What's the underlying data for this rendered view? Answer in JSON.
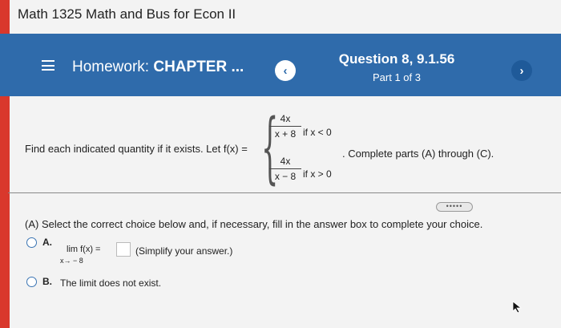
{
  "course": {
    "title": "Math 1325 Math and Bus for Econ II"
  },
  "header": {
    "homework_prefix": "Homework: ",
    "homework_title": "CHAPTER ...",
    "question_title": "Question 8, 9.1.56",
    "part_label": "Part 1 of 3",
    "prev_label": "‹",
    "next_label": "›"
  },
  "problem": {
    "intro": "Find each indicated quantity if it exists. Let f(x) =",
    "piece1_num": "4x",
    "piece1_den": "x + 8",
    "piece1_cond": "if x < 0",
    "piece2_num": "4x",
    "piece2_den": "x − 8",
    "piece2_cond": "if x > 0",
    "tail": ". Complete parts (A) through (C)."
  },
  "expand_dots": "•••••",
  "part_a": {
    "instruction": "(A) Select the correct choice below and, if necessary, fill in the answer box to complete your choice.",
    "option_a_letter": "A.",
    "lim_label": "lim  f(x) =",
    "lim_sub": "x→ − 8",
    "simplify_hint": "(Simplify your answer.)",
    "option_b_letter": "B.",
    "option_b_text": "The limit does not exist."
  },
  "colors": {
    "header": "#2f6bab",
    "left_bar": "#d9382c"
  }
}
